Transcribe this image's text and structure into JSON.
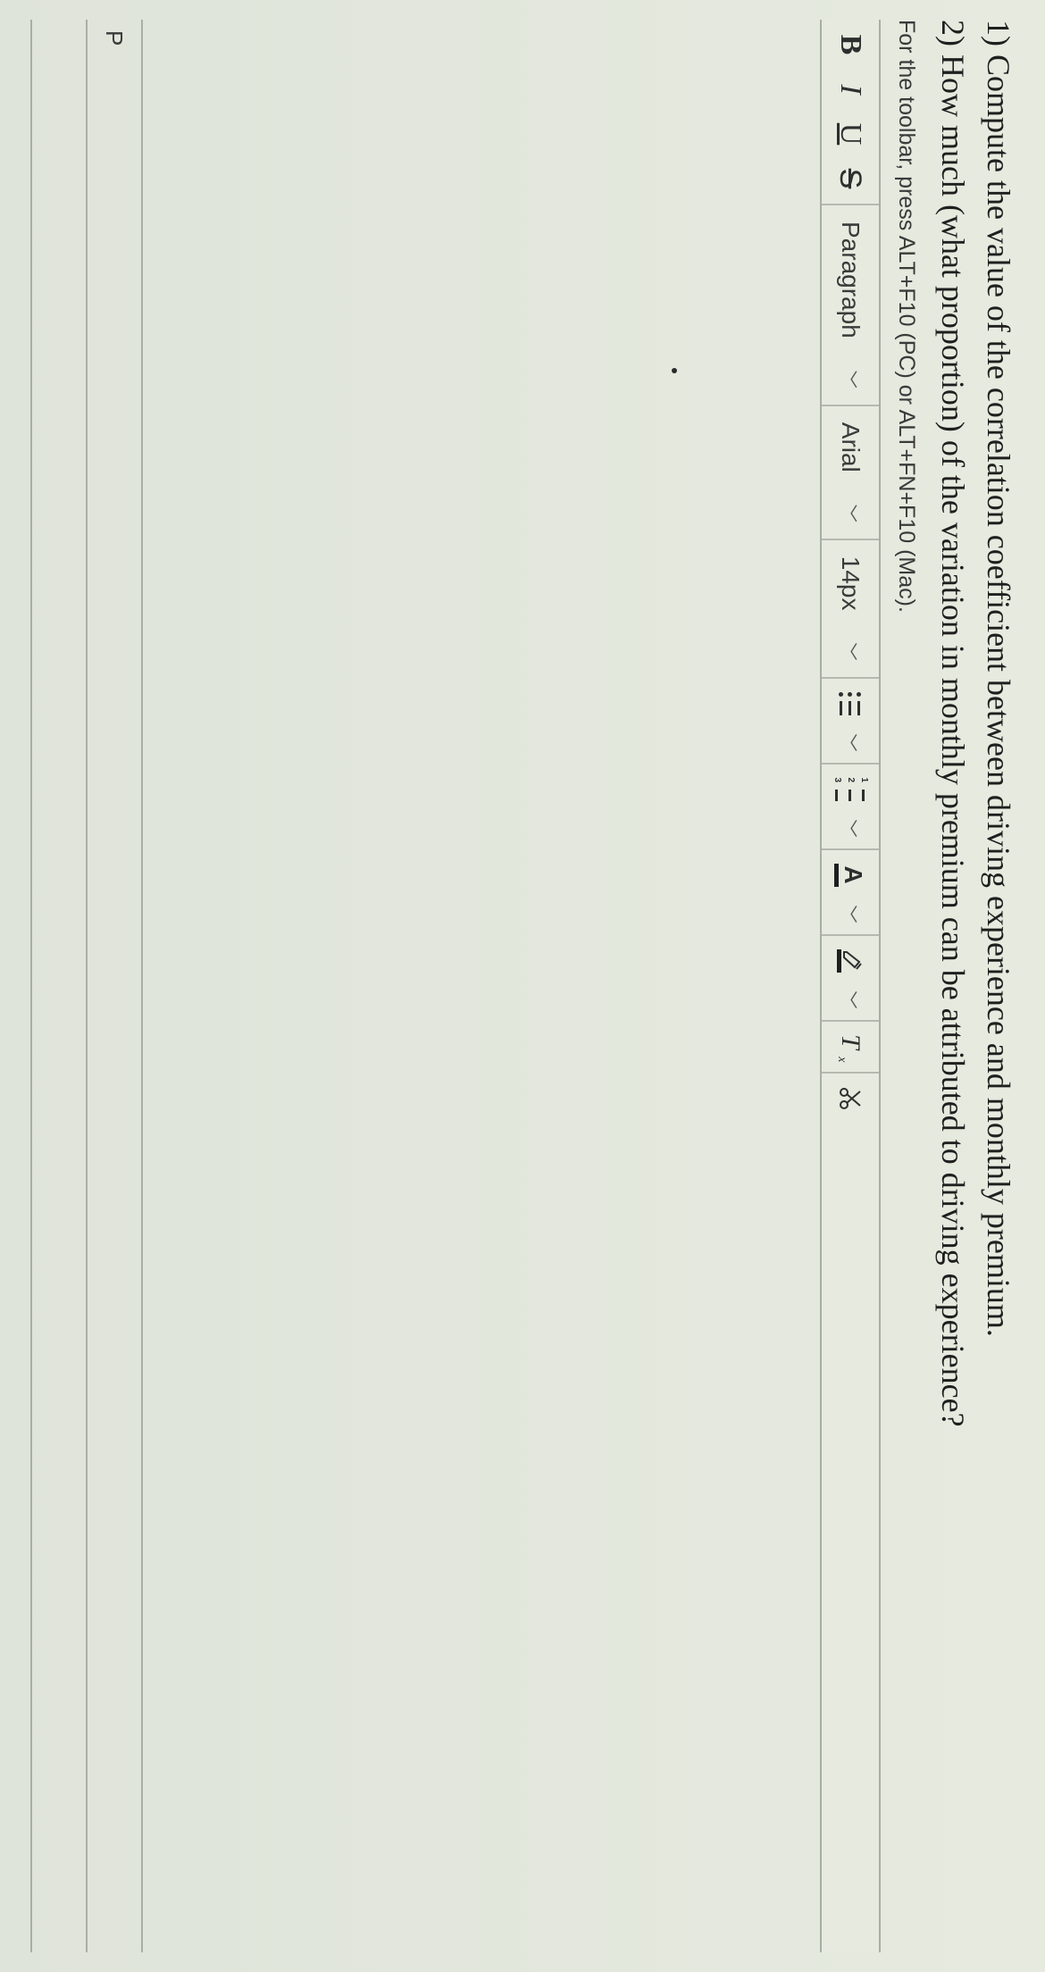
{
  "questions": {
    "q1": "1) Compute the value of the correlation coefficient between driving experience and monthly premium.",
    "q2": "2) How much (what proportion) of the variation in monthly premium can be attributed to driving experience?"
  },
  "helper": "For the toolbar, press ALT+F10 (PC) or ALT+FN+F10 (Mac).",
  "toolbar": {
    "bold_label": "B",
    "italic_label": "I",
    "underline_label": "U",
    "strike_label": "S",
    "block_format": "Paragraph",
    "font_family": "Arial",
    "font_size": "14px",
    "text_color_glyph": "A",
    "clear_format_glyph": "T",
    "clear_format_sub": "x"
  },
  "statusbar": {
    "path": "P"
  }
}
